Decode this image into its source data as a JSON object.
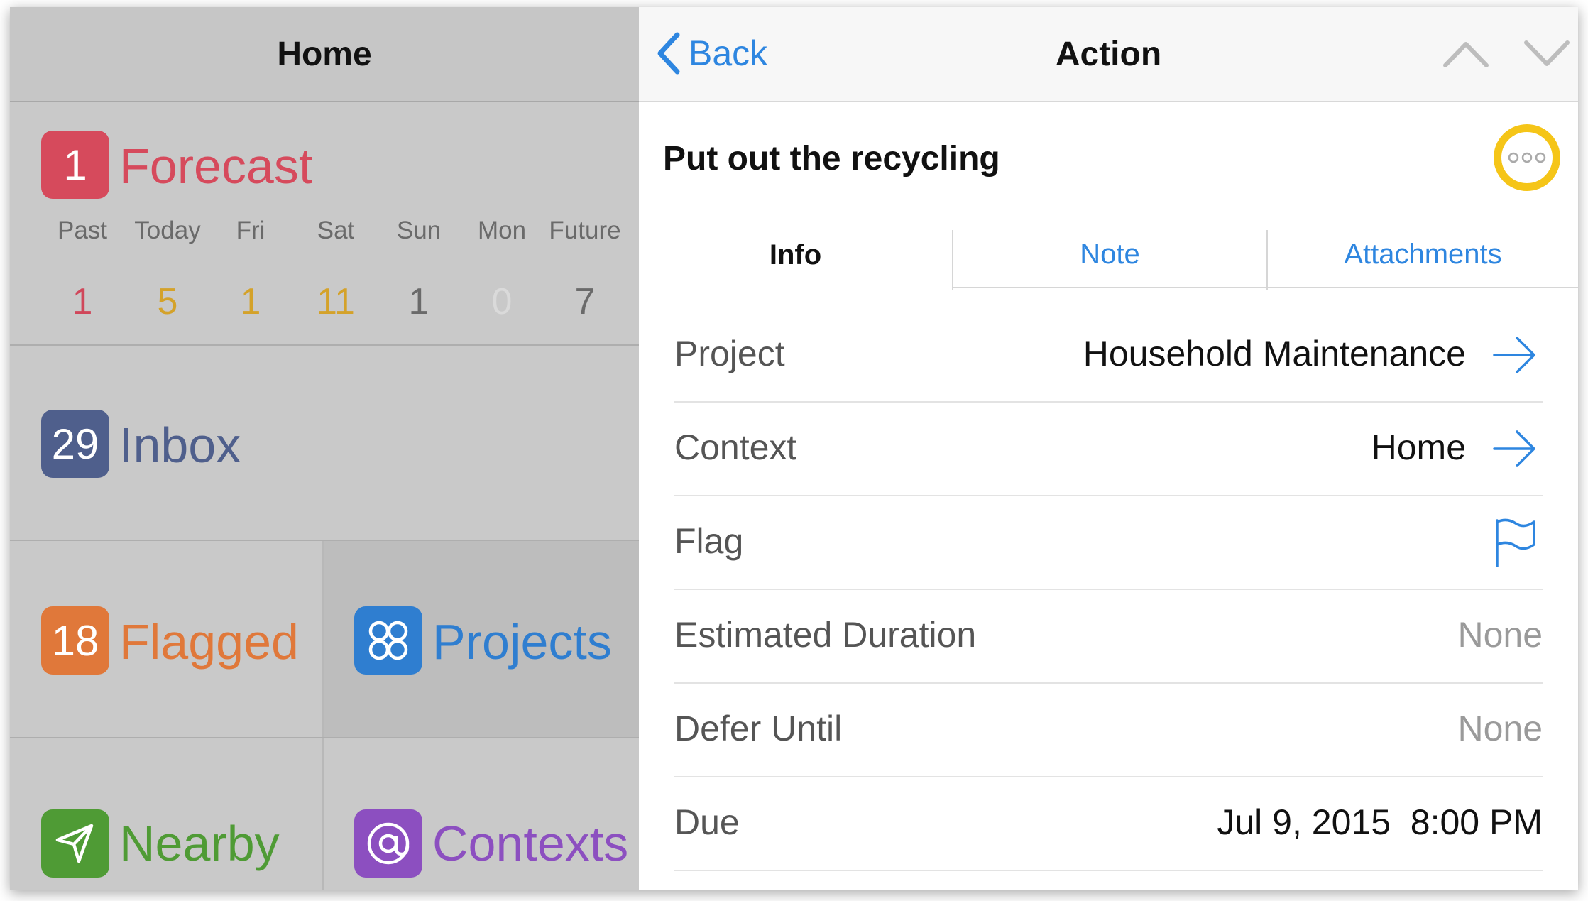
{
  "left_pane": {
    "title": "Home",
    "forecast": {
      "badge": "1",
      "label": "Forecast",
      "color": "#d64a5c",
      "days": [
        {
          "label": "Past",
          "count": "1",
          "color": "#d0475a"
        },
        {
          "label": "Today",
          "count": "5",
          "color": "#d4a22a"
        },
        {
          "label": "Fri",
          "count": "1",
          "color": "#d4a22a"
        },
        {
          "label": "Sat",
          "count": "11",
          "color": "#d4a22a"
        },
        {
          "label": "Sun",
          "count": "1",
          "color": "#6a6a6a"
        },
        {
          "label": "Mon",
          "count": "0",
          "color": "#dadada"
        },
        {
          "label": "Future",
          "count": "7",
          "color": "#6a6a6a"
        }
      ]
    },
    "inbox": {
      "badge": "29",
      "label": "Inbox",
      "color": "#4f5f8c"
    },
    "flagged": {
      "badge": "18",
      "label": "Flagged",
      "color": "#e0783a"
    },
    "projects": {
      "label": "Projects",
      "color": "#2f7ed0"
    },
    "nearby": {
      "label": "Nearby",
      "color": "#4f9b35"
    },
    "contexts": {
      "label": "Contexts",
      "color": "#8c4fc0"
    }
  },
  "right_pane": {
    "nav": {
      "back_label": "Back",
      "title": "Action"
    },
    "action_title": "Put out the recycling",
    "tabs": [
      {
        "label": "Info",
        "active": true
      },
      {
        "label": "Note",
        "active": false
      },
      {
        "label": "Attachments",
        "active": false
      }
    ],
    "fields": {
      "project": {
        "label": "Project",
        "value": "Household Maintenance"
      },
      "context": {
        "label": "Context",
        "value": "Home"
      },
      "flag": {
        "label": "Flag"
      },
      "estimated_duration": {
        "label": "Estimated Duration",
        "value": "None"
      },
      "defer_until": {
        "label": "Defer Until",
        "value": "None"
      },
      "due": {
        "label": "Due",
        "value": "Jul 9, 2015  8:00 PM"
      }
    },
    "colors": {
      "accent": "#2e86e0",
      "highlight": "#f5c518"
    }
  }
}
